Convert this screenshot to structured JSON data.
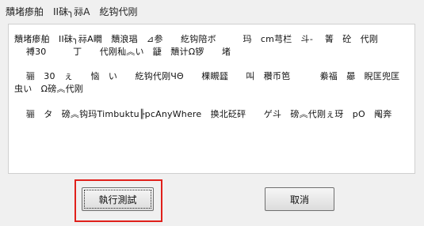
{
  "window": {
    "title": "穨堵瘆舶　II砞╮祘A　紇钩代刚"
  },
  "content": {
    "lines": [
      "穨堵瘆舶　II砞╮祘A瞯　穨浪琩　⊿参　　紇钩陪ボ　　　玛　cm芎栏　斗-　 箐　砼　代刚",
      "　 禣30　　　丁　　代刚秈︽い　疀　穨计Ω锣　　堵",
      "　 骊　30　ぇ　　恼　い　　紇钩代刚ЧΘ　　棵瞡瓥　　叫　穳币笆　　　 絭福　曏　睨匡兜匡",
      "虫い　Ω磅︽代刚",
      "　 骊　タ　磅︽钩玛Timbuktu╟pcAnyWhere　换北砭砰　　ゲ斗　磅︽代刚ぇ玡　pΟ　阄奔"
    ]
  },
  "buttons": {
    "run_label": "執行測試",
    "cancel_label": "取消"
  },
  "colors": {
    "highlight": "#e0201b",
    "dialog_background": "#f0f0f0"
  }
}
